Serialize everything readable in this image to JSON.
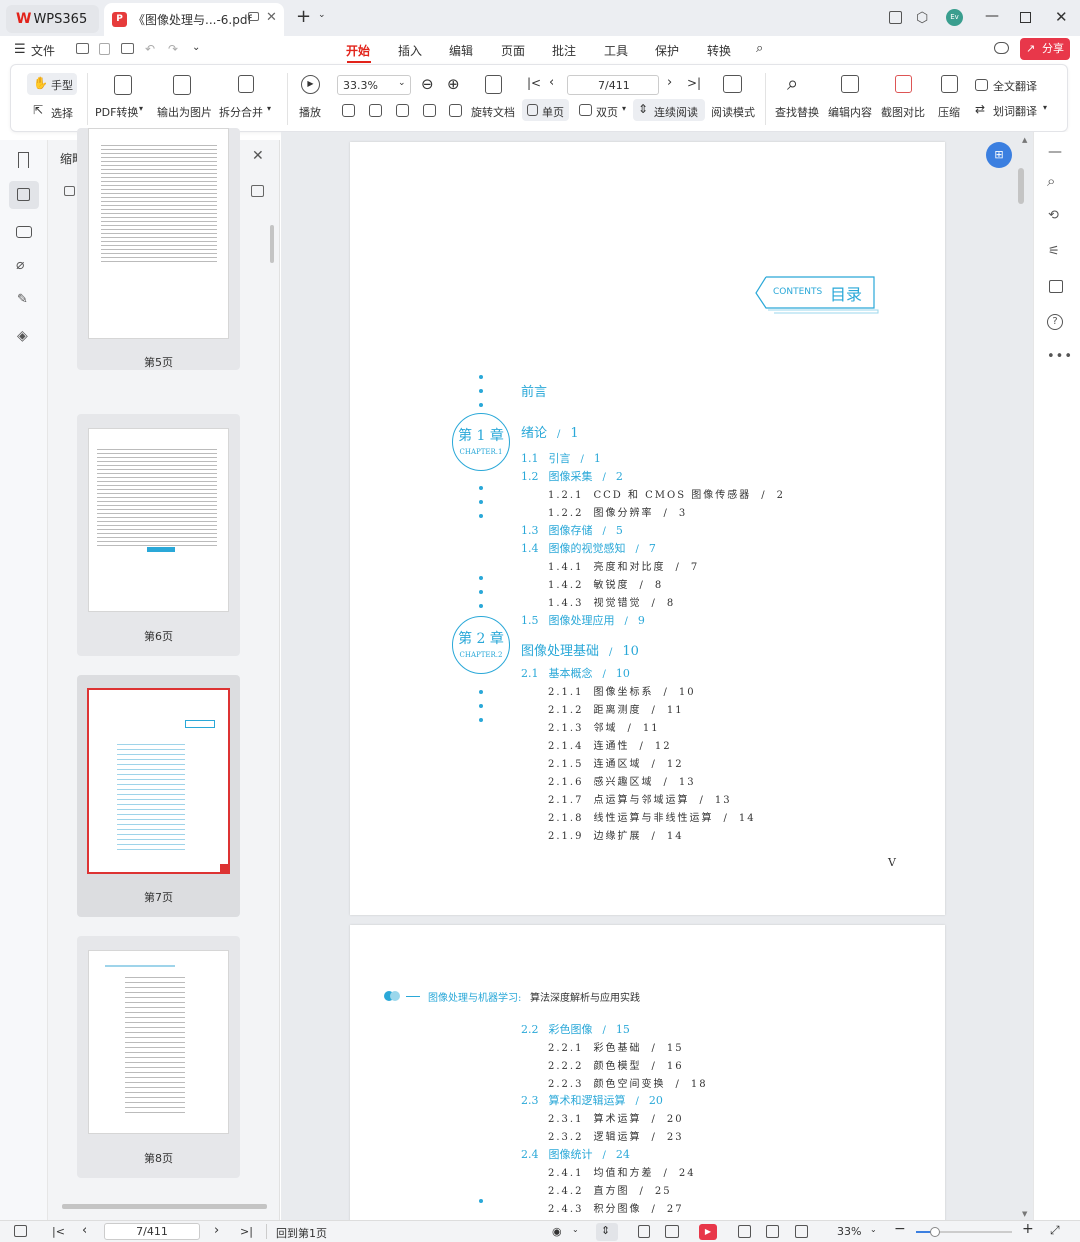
{
  "app": {
    "logo": "WPS365"
  },
  "doc_tab": {
    "title": "《图像处理与...-6.pdf"
  },
  "menu": {
    "file": "文件",
    "tabs": [
      "开始",
      "插入",
      "编辑",
      "页面",
      "批注",
      "工具",
      "保护",
      "转换"
    ],
    "share": "分享"
  },
  "ribbon": {
    "hand": "手型",
    "select": "选择",
    "pdf_convert": "PDF转换",
    "export_image": "输出为图片",
    "split_merge": "拆分合并",
    "play": "播放",
    "zoom": "33.3%",
    "rotate": "旋转文档",
    "single": "单页",
    "double": "双页",
    "continuous": "连续阅读",
    "read_mode": "阅读模式",
    "page_indicator": "7/411",
    "find_replace": "查找替换",
    "edit_content": "编辑内容",
    "screenshot_compare": "截图对比",
    "compress": "压缩",
    "full_translate": "全文翻译",
    "word_translate": "划词翻译"
  },
  "thumbs": {
    "title": "缩略图",
    "pages": [
      "第5页",
      "第6页",
      "第7页",
      "第8页"
    ]
  },
  "page7": {
    "contents_en": "CONTENTS",
    "contents_cn": "目录",
    "page_roman": "V",
    "chapters": [
      {
        "cn": "第 1 章",
        "en": "CHAPTER.1"
      },
      {
        "cn": "第 2 章",
        "en": "CHAPTER.2"
      }
    ],
    "entries": [
      {
        "num": "",
        "title": "前言",
        "page": "",
        "level": "h"
      },
      {
        "num": "",
        "title": "绪论",
        "page": "1",
        "level": "h"
      },
      {
        "num": "1.1",
        "title": "引言",
        "page": "1",
        "level": "1"
      },
      {
        "num": "1.2",
        "title": "图像采集",
        "page": "2",
        "level": "1"
      },
      {
        "num": "1.2.1",
        "title": "CCD 和 CMOS 图像传感器",
        "page": "2",
        "level": "2"
      },
      {
        "num": "1.2.2",
        "title": "图像分辨率",
        "page": "3",
        "level": "2"
      },
      {
        "num": "1.3",
        "title": "图像存储",
        "page": "5",
        "level": "1"
      },
      {
        "num": "1.4",
        "title": "图像的视觉感知",
        "page": "7",
        "level": "1"
      },
      {
        "num": "1.4.1",
        "title": "亮度和对比度",
        "page": "7",
        "level": "2"
      },
      {
        "num": "1.4.2",
        "title": "敏锐度",
        "page": "8",
        "level": "2"
      },
      {
        "num": "1.4.3",
        "title": "视觉错觉",
        "page": "8",
        "level": "2"
      },
      {
        "num": "1.5",
        "title": "图像处理应用",
        "page": "9",
        "level": "1"
      },
      {
        "num": "",
        "title": "图像处理基础",
        "page": "10",
        "level": "h"
      },
      {
        "num": "2.1",
        "title": "基本概念",
        "page": "10",
        "level": "1"
      },
      {
        "num": "2.1.1",
        "title": "图像坐标系",
        "page": "10",
        "level": "2"
      },
      {
        "num": "2.1.2",
        "title": "距离测度",
        "page": "11",
        "level": "2"
      },
      {
        "num": "2.1.3",
        "title": "邻域",
        "page": "11",
        "level": "2"
      },
      {
        "num": "2.1.4",
        "title": "连通性",
        "page": "12",
        "level": "2"
      },
      {
        "num": "2.1.5",
        "title": "连通区域",
        "page": "12",
        "level": "2"
      },
      {
        "num": "2.1.6",
        "title": "感兴趣区域",
        "page": "13",
        "level": "2"
      },
      {
        "num": "2.1.7",
        "title": "点运算与邻域运算",
        "page": "13",
        "level": "2"
      },
      {
        "num": "2.1.8",
        "title": "线性运算与非线性运算",
        "page": "14",
        "level": "2"
      },
      {
        "num": "2.1.9",
        "title": "边缘扩展",
        "page": "14",
        "level": "2"
      }
    ]
  },
  "page8": {
    "header_blue": "图像处理与机器学习:",
    "header_dark": "算法深度解析与应用实践",
    "entries": [
      {
        "num": "2.2",
        "title": "彩色图像",
        "page": "15",
        "level": "1"
      },
      {
        "num": "2.2.1",
        "title": "彩色基础",
        "page": "15",
        "level": "2"
      },
      {
        "num": "2.2.2",
        "title": "颜色模型",
        "page": "16",
        "level": "2"
      },
      {
        "num": "2.2.3",
        "title": "颜色空间变换",
        "page": "18",
        "level": "2"
      },
      {
        "num": "2.3",
        "title": "算术和逻辑运算",
        "page": "20",
        "level": "1"
      },
      {
        "num": "2.3.1",
        "title": "算术运算",
        "page": "20",
        "level": "2"
      },
      {
        "num": "2.3.2",
        "title": "逻辑运算",
        "page": "23",
        "level": "2"
      },
      {
        "num": "2.4",
        "title": "图像统计",
        "page": "24",
        "level": "1"
      },
      {
        "num": "2.4.1",
        "title": "均值和方差",
        "page": "24",
        "level": "2"
      },
      {
        "num": "2.4.2",
        "title": "直方图",
        "page": "25",
        "level": "2"
      },
      {
        "num": "2.4.3",
        "title": "积分图像",
        "page": "27",
        "level": "2"
      }
    ]
  },
  "status": {
    "page": "7/411",
    "back": "回到第1页",
    "zoom": "33%"
  },
  "colors": {
    "accent": "#2aa8d8",
    "brand_red": "#e2231a",
    "active_tab": "#e2231a"
  }
}
